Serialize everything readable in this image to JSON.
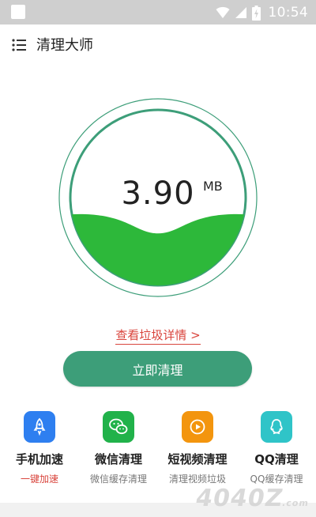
{
  "status_bar": {
    "time": "10:54"
  },
  "app": {
    "title": "清理大师"
  },
  "junk": {
    "size_value": "3.90",
    "size_unit": "MB",
    "fill_level": 0.35
  },
  "detail_link": "查看垃圾详情 >",
  "clean_button": "立即清理",
  "features": [
    {
      "title": "手机加速",
      "subtitle": "一键加速",
      "icon": "rocket-icon",
      "color": "#2e7ff0"
    },
    {
      "title": "微信清理",
      "subtitle": "微信缓存清理",
      "icon": "wechat-icon",
      "color": "#21b24a"
    },
    {
      "title": "短视频清理",
      "subtitle": "清理视频垃圾",
      "icon": "video-play-icon",
      "color": "#f3950e"
    },
    {
      "title": "QQ清理",
      "subtitle": "QQ缓存清理",
      "icon": "qq-icon",
      "color": "#2fc4c8"
    }
  ],
  "colors": {
    "accent_green": "#3d9e79",
    "water_green": "#2db83a",
    "link_red": "#d9453d"
  },
  "watermark": {
    "text": "4040Z",
    "suffix": ".com"
  }
}
